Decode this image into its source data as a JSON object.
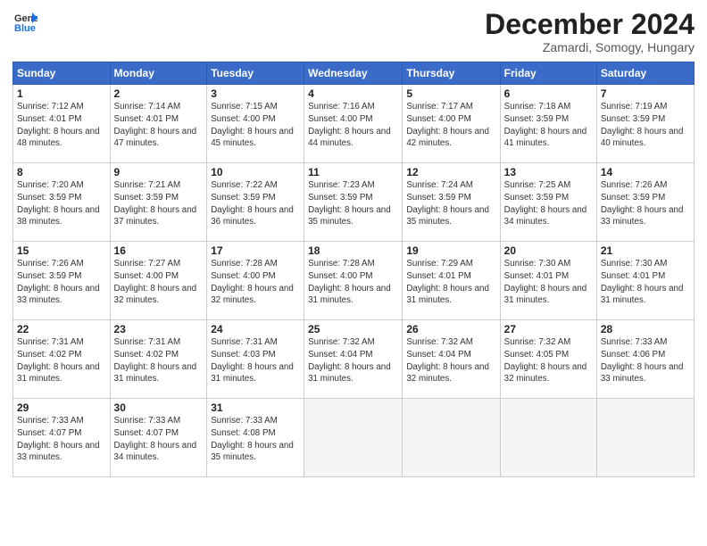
{
  "logo": {
    "line1": "General",
    "line2": "Blue"
  },
  "title": "December 2024",
  "subtitle": "Zamardi, Somogy, Hungary",
  "headers": [
    "Sunday",
    "Monday",
    "Tuesday",
    "Wednesday",
    "Thursday",
    "Friday",
    "Saturday"
  ],
  "weeks": [
    [
      {
        "day": "1",
        "sunrise": "7:12 AM",
        "sunset": "4:01 PM",
        "daylight": "8 hours and 48 minutes."
      },
      {
        "day": "2",
        "sunrise": "7:14 AM",
        "sunset": "4:01 PM",
        "daylight": "8 hours and 47 minutes."
      },
      {
        "day": "3",
        "sunrise": "7:15 AM",
        "sunset": "4:00 PM",
        "daylight": "8 hours and 45 minutes."
      },
      {
        "day": "4",
        "sunrise": "7:16 AM",
        "sunset": "4:00 PM",
        "daylight": "8 hours and 44 minutes."
      },
      {
        "day": "5",
        "sunrise": "7:17 AM",
        "sunset": "4:00 PM",
        "daylight": "8 hours and 42 minutes."
      },
      {
        "day": "6",
        "sunrise": "7:18 AM",
        "sunset": "3:59 PM",
        "daylight": "8 hours and 41 minutes."
      },
      {
        "day": "7",
        "sunrise": "7:19 AM",
        "sunset": "3:59 PM",
        "daylight": "8 hours and 40 minutes."
      }
    ],
    [
      {
        "day": "8",
        "sunrise": "7:20 AM",
        "sunset": "3:59 PM",
        "daylight": "8 hours and 38 minutes."
      },
      {
        "day": "9",
        "sunrise": "7:21 AM",
        "sunset": "3:59 PM",
        "daylight": "8 hours and 37 minutes."
      },
      {
        "day": "10",
        "sunrise": "7:22 AM",
        "sunset": "3:59 PM",
        "daylight": "8 hours and 36 minutes."
      },
      {
        "day": "11",
        "sunrise": "7:23 AM",
        "sunset": "3:59 PM",
        "daylight": "8 hours and 35 minutes."
      },
      {
        "day": "12",
        "sunrise": "7:24 AM",
        "sunset": "3:59 PM",
        "daylight": "8 hours and 35 minutes."
      },
      {
        "day": "13",
        "sunrise": "7:25 AM",
        "sunset": "3:59 PM",
        "daylight": "8 hours and 34 minutes."
      },
      {
        "day": "14",
        "sunrise": "7:26 AM",
        "sunset": "3:59 PM",
        "daylight": "8 hours and 33 minutes."
      }
    ],
    [
      {
        "day": "15",
        "sunrise": "7:26 AM",
        "sunset": "3:59 PM",
        "daylight": "8 hours and 33 minutes."
      },
      {
        "day": "16",
        "sunrise": "7:27 AM",
        "sunset": "4:00 PM",
        "daylight": "8 hours and 32 minutes."
      },
      {
        "day": "17",
        "sunrise": "7:28 AM",
        "sunset": "4:00 PM",
        "daylight": "8 hours and 32 minutes."
      },
      {
        "day": "18",
        "sunrise": "7:28 AM",
        "sunset": "4:00 PM",
        "daylight": "8 hours and 31 minutes."
      },
      {
        "day": "19",
        "sunrise": "7:29 AM",
        "sunset": "4:01 PM",
        "daylight": "8 hours and 31 minutes."
      },
      {
        "day": "20",
        "sunrise": "7:30 AM",
        "sunset": "4:01 PM",
        "daylight": "8 hours and 31 minutes."
      },
      {
        "day": "21",
        "sunrise": "7:30 AM",
        "sunset": "4:01 PM",
        "daylight": "8 hours and 31 minutes."
      }
    ],
    [
      {
        "day": "22",
        "sunrise": "7:31 AM",
        "sunset": "4:02 PM",
        "daylight": "8 hours and 31 minutes."
      },
      {
        "day": "23",
        "sunrise": "7:31 AM",
        "sunset": "4:02 PM",
        "daylight": "8 hours and 31 minutes."
      },
      {
        "day": "24",
        "sunrise": "7:31 AM",
        "sunset": "4:03 PM",
        "daylight": "8 hours and 31 minutes."
      },
      {
        "day": "25",
        "sunrise": "7:32 AM",
        "sunset": "4:04 PM",
        "daylight": "8 hours and 31 minutes."
      },
      {
        "day": "26",
        "sunrise": "7:32 AM",
        "sunset": "4:04 PM",
        "daylight": "8 hours and 32 minutes."
      },
      {
        "day": "27",
        "sunrise": "7:32 AM",
        "sunset": "4:05 PM",
        "daylight": "8 hours and 32 minutes."
      },
      {
        "day": "28",
        "sunrise": "7:33 AM",
        "sunset": "4:06 PM",
        "daylight": "8 hours and 33 minutes."
      }
    ],
    [
      {
        "day": "29",
        "sunrise": "7:33 AM",
        "sunset": "4:07 PM",
        "daylight": "8 hours and 33 minutes."
      },
      {
        "day": "30",
        "sunrise": "7:33 AM",
        "sunset": "4:07 PM",
        "daylight": "8 hours and 34 minutes."
      },
      {
        "day": "31",
        "sunrise": "7:33 AM",
        "sunset": "4:08 PM",
        "daylight": "8 hours and 35 minutes."
      },
      null,
      null,
      null,
      null
    ]
  ]
}
